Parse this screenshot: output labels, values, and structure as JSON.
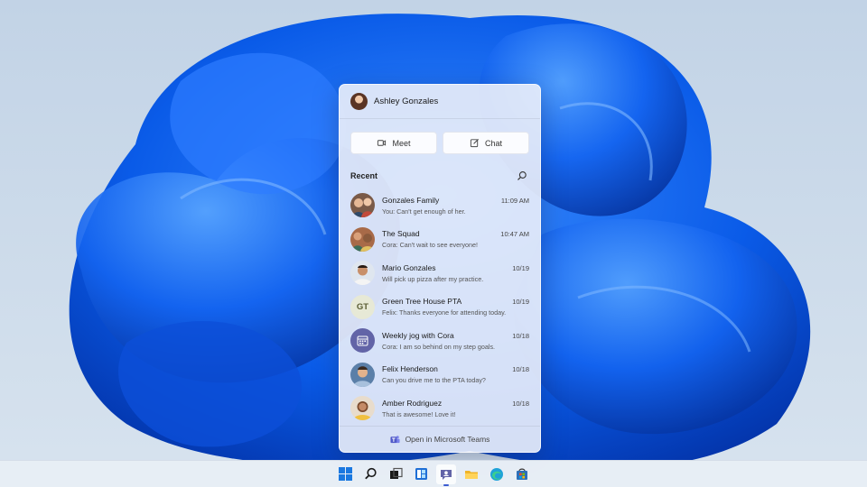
{
  "flyout": {
    "user_name": "Ashley Gonzales",
    "meet_label": "Meet",
    "chat_label": "Chat",
    "recent_title": "Recent",
    "conversations": [
      {
        "name": "Gonzales Family",
        "time": "11:09 AM",
        "message": "You: Can't get enough of her.",
        "avatar": "group"
      },
      {
        "name": "The Squad",
        "time": "10:47 AM",
        "message": "Cora: Can't wait to see everyone!",
        "avatar": "group"
      },
      {
        "name": "Mario Gonzales",
        "time": "10/19",
        "message": "Will pick up pizza after my practice.",
        "avatar": "person"
      },
      {
        "name": "Green Tree House PTA",
        "time": "10/19",
        "message": "Felix: Thanks everyone for attending today.",
        "avatar": "initials",
        "initials": "GT"
      },
      {
        "name": "Weekly jog with Cora",
        "time": "10/18",
        "message": "Cora: I am so behind on my step goals.",
        "avatar": "calendar-icon"
      },
      {
        "name": "Felix Henderson",
        "time": "10/18",
        "message": "Can you drive me to the PTA today?",
        "avatar": "person"
      },
      {
        "name": "Amber Rodriguez",
        "time": "10/18",
        "message": "That is awesome! Love it!",
        "avatar": "person"
      }
    ],
    "footer_label": "Open in Microsoft Teams"
  },
  "taskbar": {
    "items": [
      "windows-start-icon",
      "search-icon",
      "task-view-icon",
      "widgets-icon",
      "chat-icon",
      "file-explorer-icon",
      "edge-icon",
      "store-icon"
    ],
    "active": "chat-icon"
  },
  "colors": {
    "teams_purple": "#6264a7",
    "bloom_blue": "#0a5be8",
    "taskbar_accent": "#3a5bd0"
  }
}
